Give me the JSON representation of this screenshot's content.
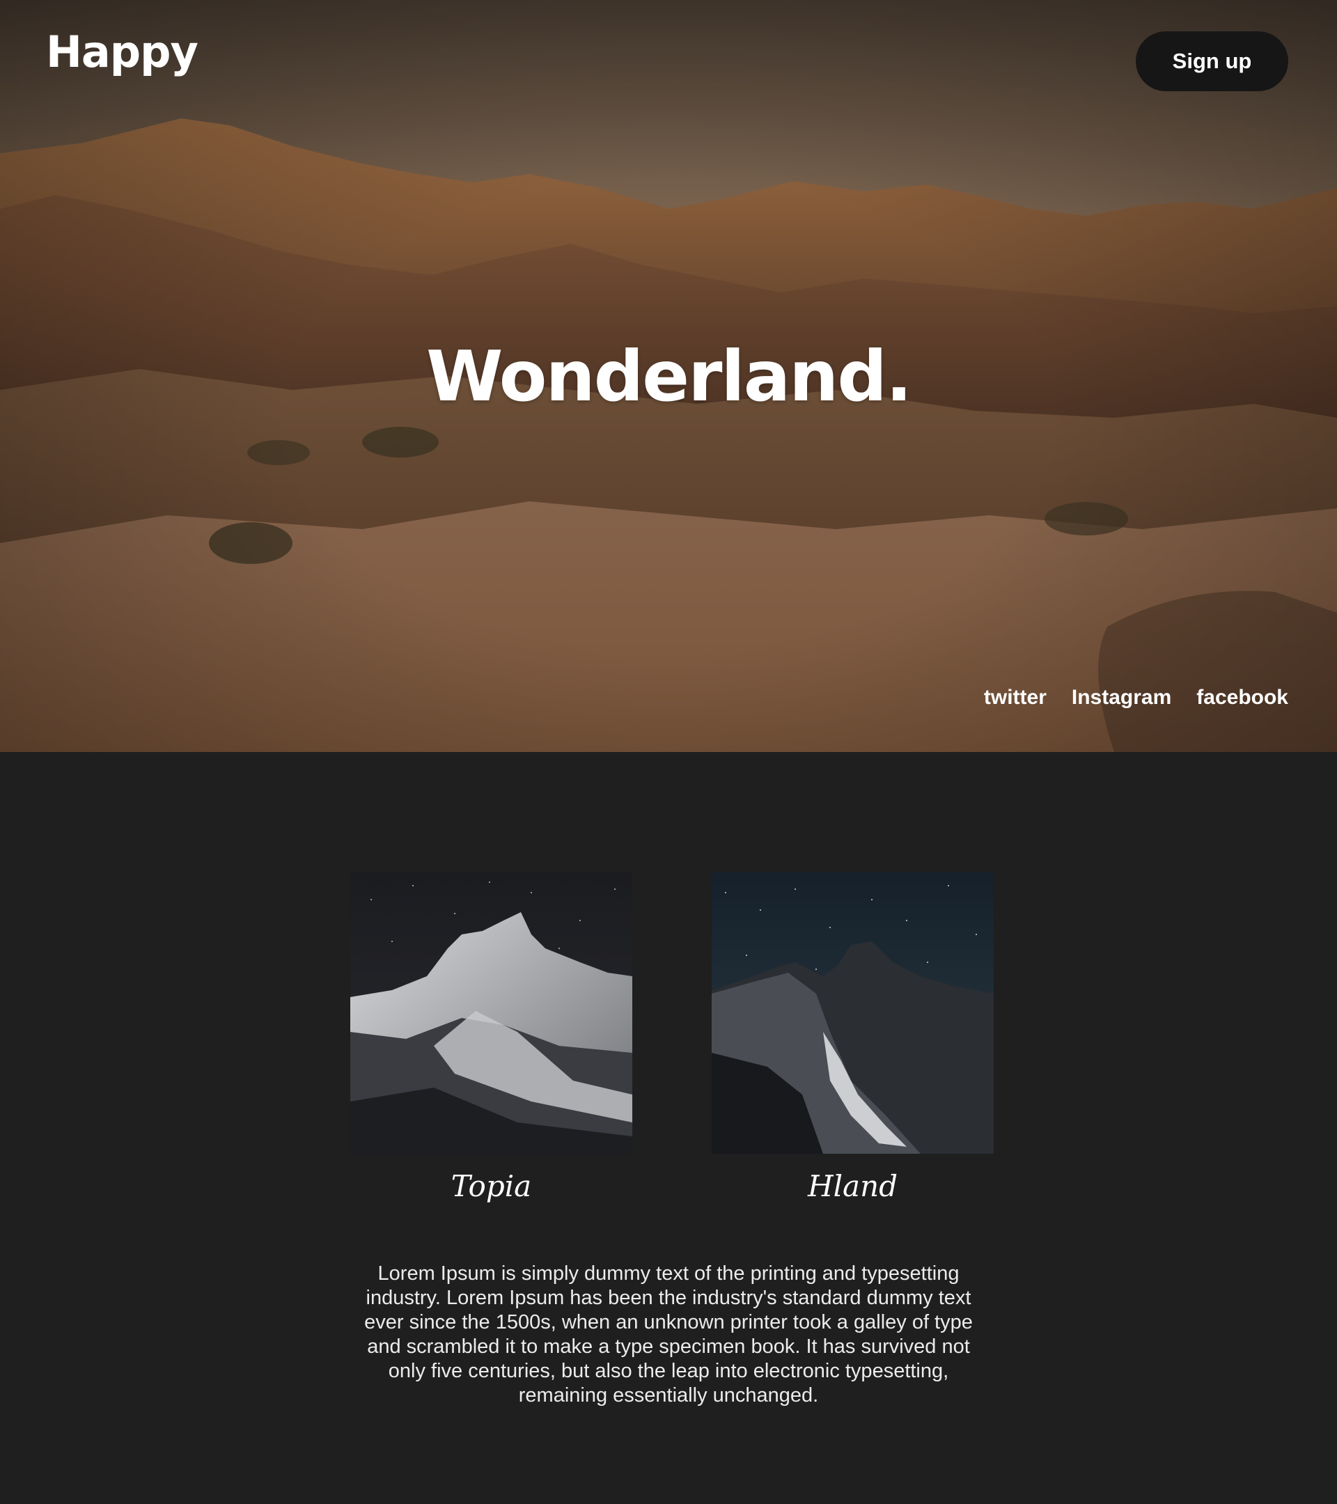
{
  "header": {
    "logo": "Happy",
    "signup_label": "Sign up"
  },
  "hero": {
    "title": "Wonderland."
  },
  "social": {
    "links": [
      "twitter",
      "Instagram",
      "facebook"
    ]
  },
  "cards": [
    {
      "name": "Topia"
    },
    {
      "name": "Hland"
    }
  ],
  "description": "Lorem Ipsum is simply dummy text of the printing and typesetting industry. Lorem Ipsum has been the industry's standard dummy text ever since the 1500s, when an unknown printer took a galley of type and scrambled it to make a type specimen book. It has survived not only five centuries, but also the leap into electronic typesetting, remaining essentially unchanged.",
  "colors": {
    "page_background": "#1f1f1f",
    "signup_background": "#161616",
    "text": "#ffffff"
  }
}
